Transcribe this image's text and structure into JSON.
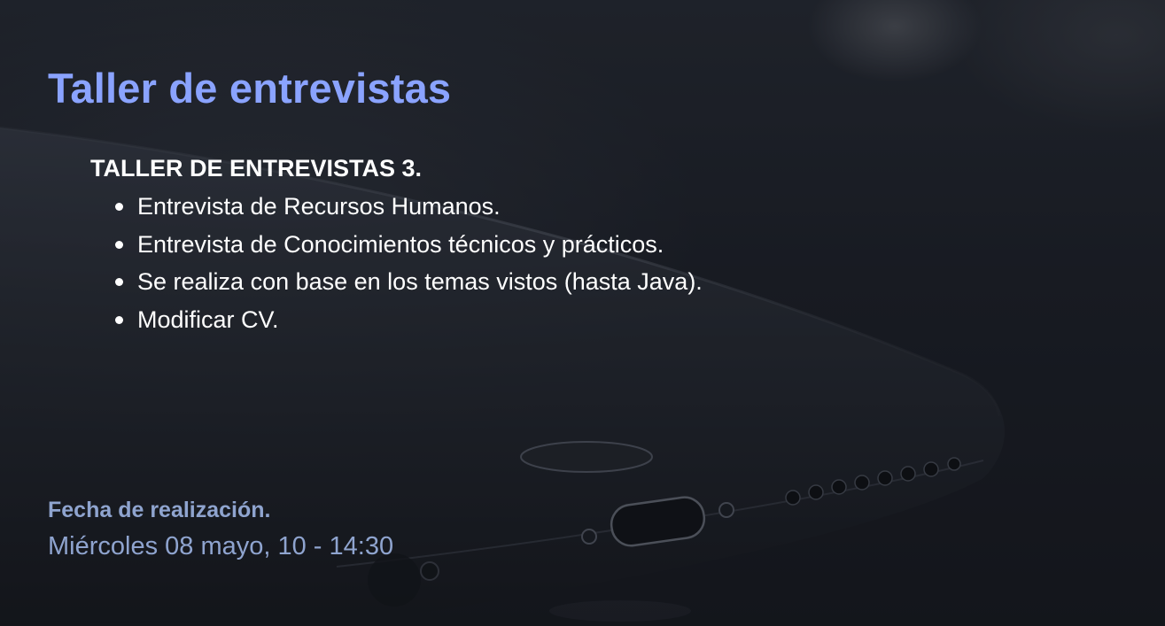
{
  "slide": {
    "title": "Taller de entrevistas",
    "section_heading": "TALLER DE ENTREVISTAS 3.",
    "bullets": [
      "Entrevista de Recursos Humanos.",
      "Entrevista de Conocimientos técnicos y prácticos.",
      "Se realiza con base en los temas vistos (hasta Java).",
      "Modificar CV."
    ],
    "date_label": "Fecha de realización.",
    "date_value": "Miércoles 08 mayo, 10 - 14:30"
  },
  "colors": {
    "title": "#8aa3ff",
    "body_text": "#ffffff",
    "date_text": "#8fa4cf",
    "background": "#1a1d24"
  }
}
